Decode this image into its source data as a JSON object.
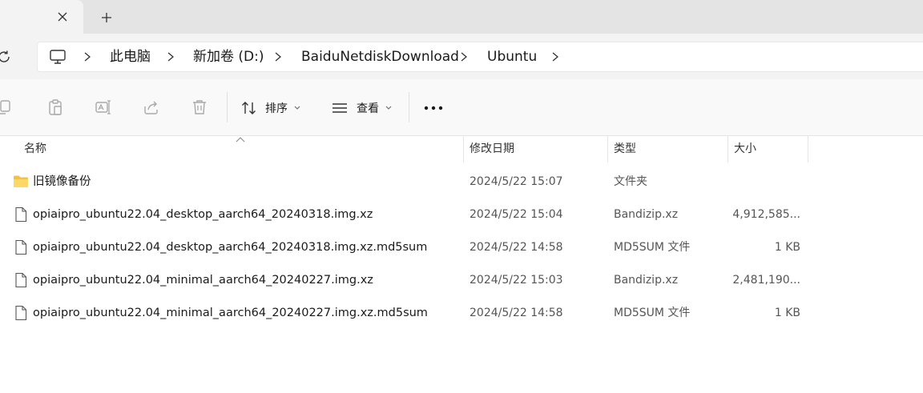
{
  "breadcrumb": {
    "items": [
      "此电脑",
      "新加卷 (D:)",
      "BaiduNetdiskDownload",
      "Ubuntu"
    ]
  },
  "toolbar": {
    "sort_label": "排序",
    "view_label": "查看",
    "more_label": "•••"
  },
  "columns": {
    "name": "名称",
    "modified": "修改日期",
    "type": "类型",
    "size": "大小"
  },
  "files": [
    {
      "name": "旧镜像备份",
      "modified": "2024/5/22 15:07",
      "type": "文件夹",
      "size": "",
      "icon": "folder-icon"
    },
    {
      "name": "opiaipro_ubuntu22.04_desktop_aarch64_20240318.img.xz",
      "modified": "2024/5/22 15:04",
      "type": "Bandizip.xz",
      "size": "4,912,585...",
      "icon": "file-icon"
    },
    {
      "name": "opiaipro_ubuntu22.04_desktop_aarch64_20240318.img.xz.md5sum",
      "modified": "2024/5/22 14:58",
      "type": "MD5SUM 文件",
      "size": "1 KB",
      "icon": "file-icon"
    },
    {
      "name": "opiaipro_ubuntu22.04_minimal_aarch64_20240227.img.xz",
      "modified": "2024/5/22 15:03",
      "type": "Bandizip.xz",
      "size": "2,481,190...",
      "icon": "file-icon"
    },
    {
      "name": "opiaipro_ubuntu22.04_minimal_aarch64_20240227.img.xz.md5sum",
      "modified": "2024/5/22 14:58",
      "type": "MD5SUM 文件",
      "size": "1 KB",
      "icon": "file-icon"
    }
  ],
  "colors": {
    "folder": "#F4C145",
    "accent": "#0067C0",
    "disabled_icon": "#A9A9A9"
  }
}
